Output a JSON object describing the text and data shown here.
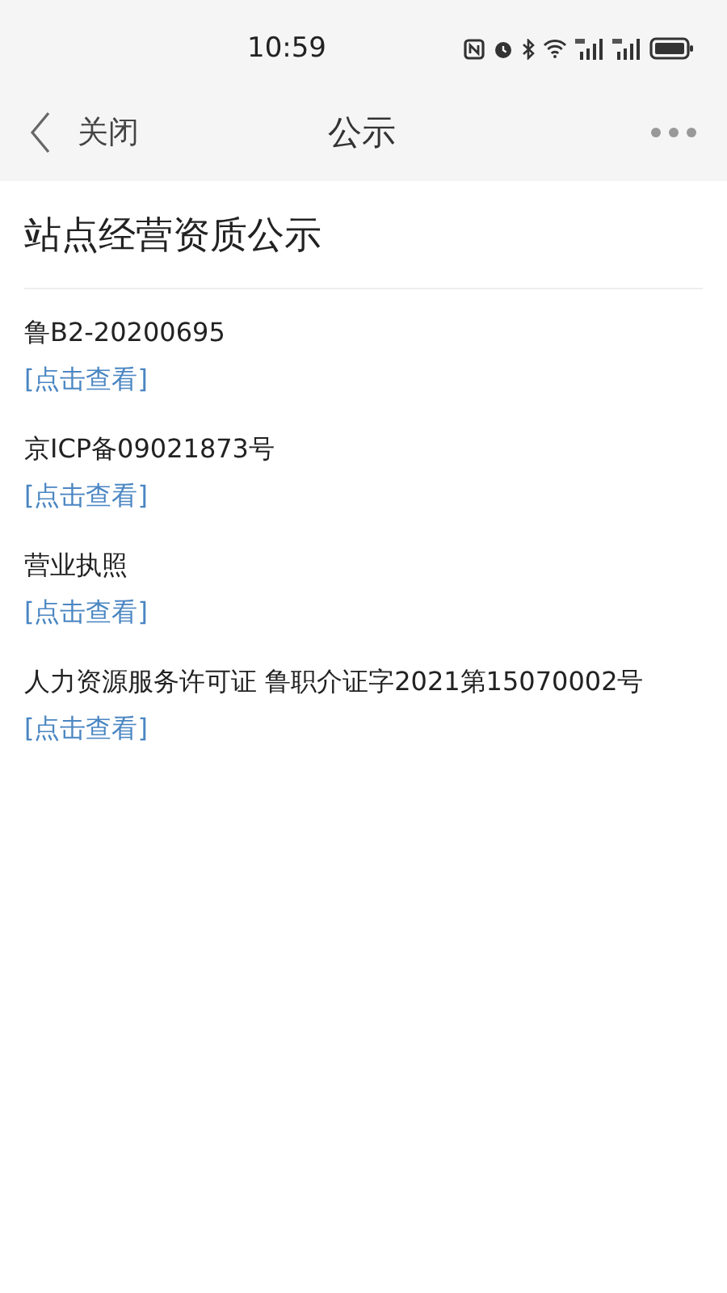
{
  "status_bar": {
    "time": "10:59"
  },
  "nav": {
    "close": "关闭",
    "title": "公示"
  },
  "page": {
    "heading": "站点经营资质公示",
    "items": [
      {
        "text": "鲁B2-20200695",
        "link": "[点击查看]"
      },
      {
        "text": "京ICP备09021873号",
        "link": "[点击查看]"
      },
      {
        "text": "营业执照",
        "link": "[点击查看]"
      },
      {
        "text": "人力资源服务许可证 鲁职介证字2021第15070002号",
        "link": "[点击查看]"
      }
    ]
  }
}
